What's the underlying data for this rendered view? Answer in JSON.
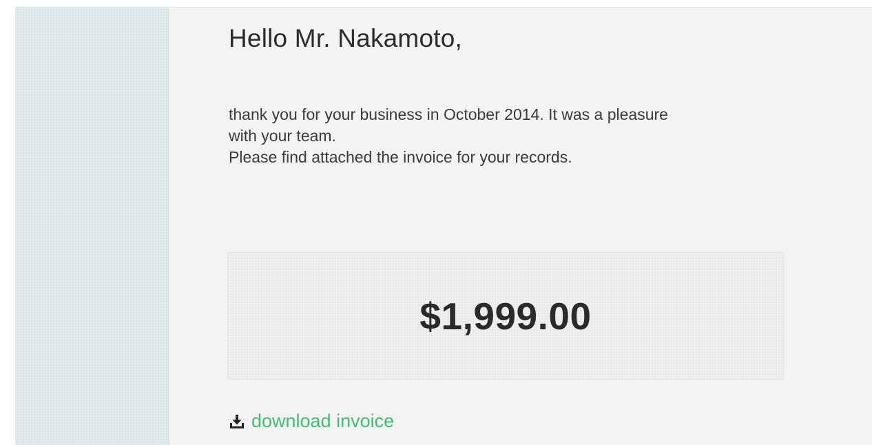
{
  "email": {
    "greeting": "Hello Mr. Nakamoto,",
    "body_line_1": "thank you for your business in October 2014. It was a pleasure",
    "body_line_2": "with your team.",
    "body_line_3": "Please find attached the invoice for your records.",
    "amount": "$1,999.00",
    "download_label": "download invoice",
    "download_icon": "download-icon"
  },
  "colors": {
    "sidebar": "#dde9ea",
    "panel": "#f3f3f3",
    "link": "#3fbf6c",
    "text": "#2b2b2b"
  }
}
